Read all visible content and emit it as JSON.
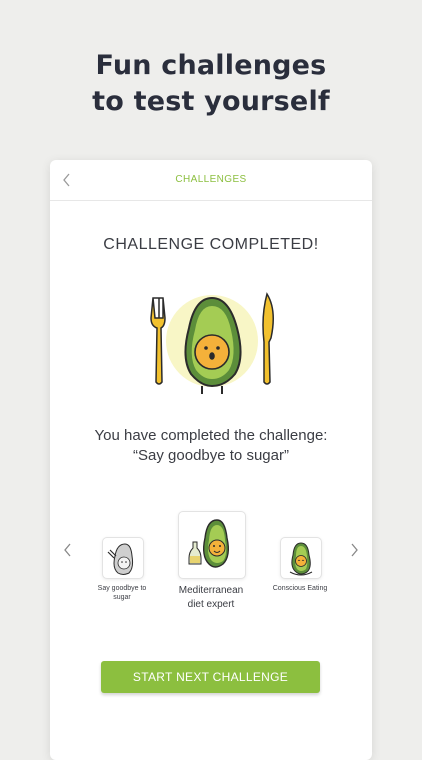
{
  "promo": {
    "headline_line1": "Fun challenges",
    "headline_line2": "to test yourself"
  },
  "header": {
    "back_icon": "chevron-left-icon",
    "title": "CHALLENGES"
  },
  "main": {
    "status": "CHALLENGE COMPLETED!",
    "message_line1": "You have completed the challenge:",
    "message_line2": "“Say goodbye to sugar”"
  },
  "carousel": {
    "items": [
      {
        "label_line1": "Say goodbye to",
        "label_line2": "sugar",
        "icon": "grey-avocado-pointing-icon"
      },
      {
        "label_line1": "Mediterranean",
        "label_line2": "diet expert",
        "icon": "avocado-olive-oil-icon"
      },
      {
        "label_line1": "Conscious Eating",
        "label_line2": "",
        "icon": "avocado-meditating-icon"
      }
    ]
  },
  "cta": {
    "label": "START NEXT CHALLENGE"
  },
  "colors": {
    "accent": "#8cbf3f",
    "avocado_skin": "#5c8e3a",
    "avocado_flesh": "#a4cc54",
    "avocado_pit": "#f4b13a",
    "cutlery": "#f2c12e"
  }
}
